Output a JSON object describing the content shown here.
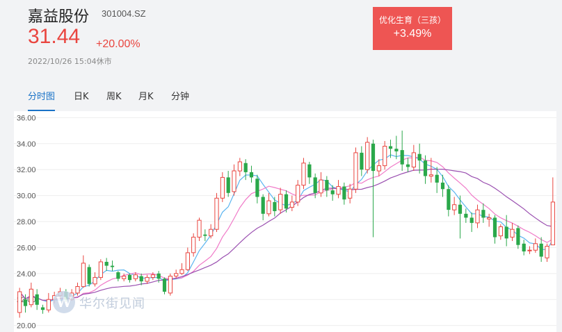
{
  "stock": {
    "name": "嘉益股份",
    "code": "301004.SZ",
    "price": "31.44",
    "change_pct": "+20.00%",
    "timestamp": "2022/10/26 15:04休市"
  },
  "sector": {
    "name": "优化生育（三孩）",
    "change": "+3.49%",
    "color": "#ee5553"
  },
  "tabs": [
    {
      "label": "分时图",
      "active": true
    },
    {
      "label": "日K",
      "active": false
    },
    {
      "label": "周K",
      "active": false
    },
    {
      "label": "月K",
      "active": false
    },
    {
      "label": "分钟",
      "active": false
    }
  ],
  "watermark": {
    "logo_letter": "W",
    "text": "华尔街见闻"
  },
  "colors": {
    "up": "#e9453f",
    "down": "#2aa84a",
    "accent": "#1a73c7",
    "ma_short": "#5ab4f0",
    "ma_mid": "#f07ac8",
    "ma_long": "#9a4fb0"
  },
  "chart_data": {
    "type": "candlestick",
    "ylim": [
      19.5,
      36.5
    ],
    "y_ticks": [
      "36.00",
      "34.00",
      "32.00",
      "30.00",
      "28.00",
      "26.00",
      "24.00",
      "22.00",
      "20.00"
    ],
    "candles": [
      [
        21.0,
        22.6,
        22.9,
        20.6
      ],
      [
        22.0,
        21.5,
        22.4,
        21.0
      ],
      [
        21.6,
        22.8,
        23.3,
        21.4
      ],
      [
        22.4,
        21.6,
        22.8,
        21.2
      ],
      [
        21.4,
        21.2,
        21.6,
        20.9
      ],
      [
        21.2,
        22.0,
        22.5,
        21.0
      ],
      [
        22.0,
        22.3,
        22.6,
        21.7
      ],
      [
        22.3,
        22.6,
        22.9,
        22.0
      ],
      [
        22.6,
        22.0,
        22.8,
        21.8
      ],
      [
        22.0,
        22.5,
        22.8,
        21.9
      ],
      [
        22.5,
        23.0,
        23.3,
        22.3
      ],
      [
        23.0,
        24.8,
        25.4,
        22.9
      ],
      [
        24.5,
        23.2,
        24.7,
        23.0
      ],
      [
        23.2,
        23.7,
        24.1,
        23.0
      ],
      [
        23.7,
        24.9,
        25.1,
        23.5
      ],
      [
        24.9,
        24.6,
        25.2,
        24.2
      ],
      [
        24.6,
        24.5,
        25.0,
        24.2
      ],
      [
        24.1,
        23.6,
        24.2,
        23.4
      ],
      [
        23.6,
        23.8,
        24.0,
        23.4
      ],
      [
        23.9,
        23.5,
        24.0,
        23.3
      ],
      [
        23.6,
        23.9,
        24.1,
        23.4
      ],
      [
        23.8,
        23.4,
        24.0,
        23.1
      ],
      [
        23.4,
        23.7,
        23.9,
        23.2
      ],
      [
        23.7,
        23.9,
        24.1,
        23.5
      ],
      [
        24.0,
        23.6,
        24.2,
        23.3
      ],
      [
        23.6,
        22.6,
        23.7,
        22.4
      ],
      [
        22.5,
        23.8,
        24.0,
        22.3
      ],
      [
        23.8,
        24.0,
        24.3,
        23.6
      ],
      [
        24.0,
        24.3,
        24.8,
        23.9
      ],
      [
        24.3,
        25.6,
        26.0,
        24.2
      ],
      [
        25.6,
        26.8,
        27.1,
        25.3
      ],
      [
        26.8,
        28.1,
        28.3,
        26.5
      ],
      [
        27.0,
        26.9,
        27.4,
        26.5
      ],
      [
        26.9,
        27.4,
        27.8,
        26.7
      ],
      [
        27.4,
        29.8,
        30.2,
        27.2
      ],
      [
        29.8,
        31.4,
        31.8,
        29.5
      ],
      [
        31.4,
        30.2,
        31.9,
        29.9
      ],
      [
        30.3,
        31.9,
        32.4,
        30.0
      ],
      [
        31.9,
        32.6,
        32.9,
        31.5
      ],
      [
        32.5,
        31.8,
        32.8,
        31.2
      ],
      [
        31.8,
        31.4,
        32.3,
        31.0
      ],
      [
        31.3,
        29.9,
        31.6,
        29.4
      ],
      [
        29.9,
        28.6,
        30.1,
        28.1
      ],
      [
        28.6,
        29.6,
        30.2,
        28.4
      ],
      [
        29.5,
        28.8,
        29.9,
        28.4
      ],
      [
        28.9,
        30.1,
        30.6,
        28.6
      ],
      [
        30.1,
        29.0,
        30.4,
        28.7
      ],
      [
        29.1,
        29.5,
        30.0,
        28.8
      ],
      [
        29.5,
        30.8,
        31.2,
        29.2
      ],
      [
        30.8,
        32.5,
        32.9,
        30.5
      ],
      [
        32.4,
        31.4,
        32.6,
        30.9
      ],
      [
        31.4,
        30.2,
        31.7,
        29.8
      ],
      [
        30.2,
        31.2,
        31.8,
        29.9
      ],
      [
        31.2,
        30.4,
        31.5,
        29.9
      ],
      [
        30.4,
        30.1,
        30.8,
        29.6
      ],
      [
        30.1,
        30.7,
        31.2,
        29.8
      ],
      [
        30.7,
        29.7,
        31.0,
        29.3
      ],
      [
        29.8,
        30.5,
        30.9,
        29.4
      ],
      [
        30.5,
        33.3,
        33.7,
        30.2
      ],
      [
        33.3,
        32.0,
        33.8,
        31.5
      ],
      [
        32.0,
        34.1,
        34.5,
        31.7
      ],
      [
        34.0,
        31.9,
        34.3,
        26.8
      ],
      [
        31.9,
        32.3,
        32.8,
        31.5
      ],
      [
        32.3,
        33.8,
        34.2,
        32.0
      ],
      [
        33.8,
        33.6,
        34.3,
        32.9
      ],
      [
        33.6,
        33.4,
        34.6,
        32.8
      ],
      [
        33.5,
        32.4,
        35.0,
        31.9
      ],
      [
        32.4,
        32.2,
        32.9,
        31.8
      ],
      [
        32.2,
        33.3,
        33.9,
        31.9
      ],
      [
        33.2,
        32.7,
        34.0,
        31.7
      ],
      [
        32.7,
        31.5,
        33.1,
        30.9
      ],
      [
        31.5,
        31.6,
        32.9,
        31.0
      ],
      [
        31.6,
        31.0,
        32.2,
        30.2
      ],
      [
        31.0,
        30.5,
        31.6,
        29.9
      ],
      [
        30.5,
        28.9,
        30.8,
        28.4
      ],
      [
        28.9,
        29.3,
        29.9,
        28.5
      ],
      [
        29.3,
        28.6,
        30.0,
        26.7
      ],
      [
        28.6,
        28.3,
        29.0,
        27.9
      ],
      [
        28.3,
        27.9,
        28.7,
        27.2
      ],
      [
        27.9,
        28.9,
        29.3,
        27.5
      ],
      [
        28.9,
        28.3,
        29.4,
        27.9
      ],
      [
        28.2,
        28.3,
        28.6,
        27.6
      ],
      [
        28.3,
        26.8,
        28.5,
        26.3
      ],
      [
        26.9,
        27.6,
        27.8,
        26.6
      ],
      [
        27.6,
        26.7,
        28.5,
        26.1
      ],
      [
        26.8,
        27.4,
        27.9,
        26.5
      ],
      [
        27.5,
        26.2,
        27.7,
        25.9
      ],
      [
        26.3,
        25.7,
        26.6,
        25.4
      ],
      [
        25.8,
        25.8,
        26.1,
        25.5
      ],
      [
        25.8,
        26.3,
        26.7,
        25.6
      ],
      [
        26.3,
        25.3,
        26.8,
        24.9
      ],
      [
        25.2,
        26.1,
        26.3,
        24.9
      ],
      [
        26.2,
        29.5,
        31.4,
        26.2
      ]
    ]
  }
}
